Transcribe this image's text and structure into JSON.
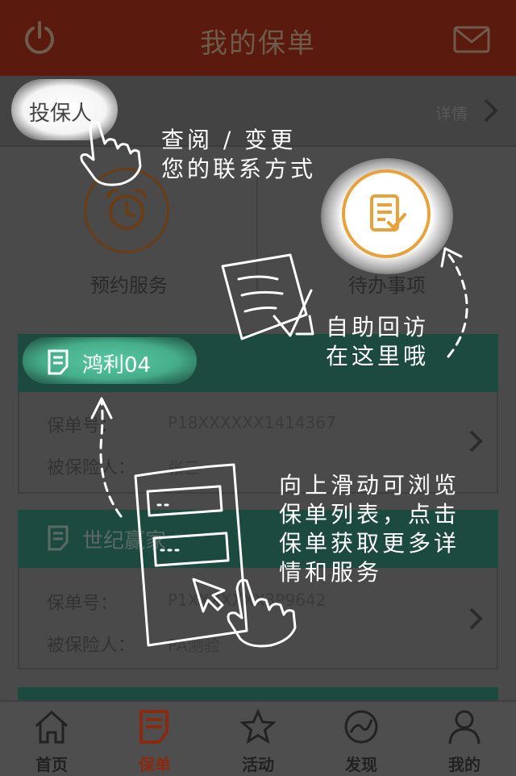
{
  "header": {
    "title": "我的保单",
    "power_icon": "power-icon",
    "mail_icon": "mail-icon"
  },
  "applicant": {
    "label": "投保人",
    "detail_link": "详情"
  },
  "actions": [
    {
      "label": "预约服务",
      "icon": "alarm-clock-icon"
    },
    {
      "label": "待办事项",
      "icon": "todo-list-icon"
    }
  ],
  "policies": [
    {
      "name": "鸿利04",
      "fields": [
        {
          "label": "保单号：",
          "value": "P18XXXXXX1414367"
        },
        {
          "label": "被保险人：",
          "value": "张三"
        }
      ]
    },
    {
      "name": "世纪赢家",
      "fields": [
        {
          "label": "保单号：",
          "value": "P1XXXXXXX3P9642"
        },
        {
          "label": "被保险人：",
          "value": "PA测验"
        }
      ]
    }
  ],
  "tutorial": {
    "tip_contact": [
      "查阅 / 变更",
      "您的联系方式"
    ],
    "tip_revisit": [
      "自助回访",
      "在这里哦"
    ],
    "tip_scroll": [
      "向上滑动可浏览",
      "保单列表，点击",
      "保单获取更多详",
      "情和服务"
    ]
  },
  "tabs": [
    {
      "label": "首页",
      "icon": "home-icon",
      "active": false
    },
    {
      "label": "保单",
      "icon": "policy-icon",
      "active": true
    },
    {
      "label": "活动",
      "icon": "star-icon",
      "active": false
    },
    {
      "label": "发现",
      "icon": "discover-icon",
      "active": false
    },
    {
      "label": "我的",
      "icon": "user-icon",
      "active": false
    }
  ],
  "colors": {
    "header_bg": "#5a1a0e",
    "card_head_bg": "#1d4a3e",
    "accent_orange": "#e8a23a",
    "tab_active": "#8a2a10"
  }
}
